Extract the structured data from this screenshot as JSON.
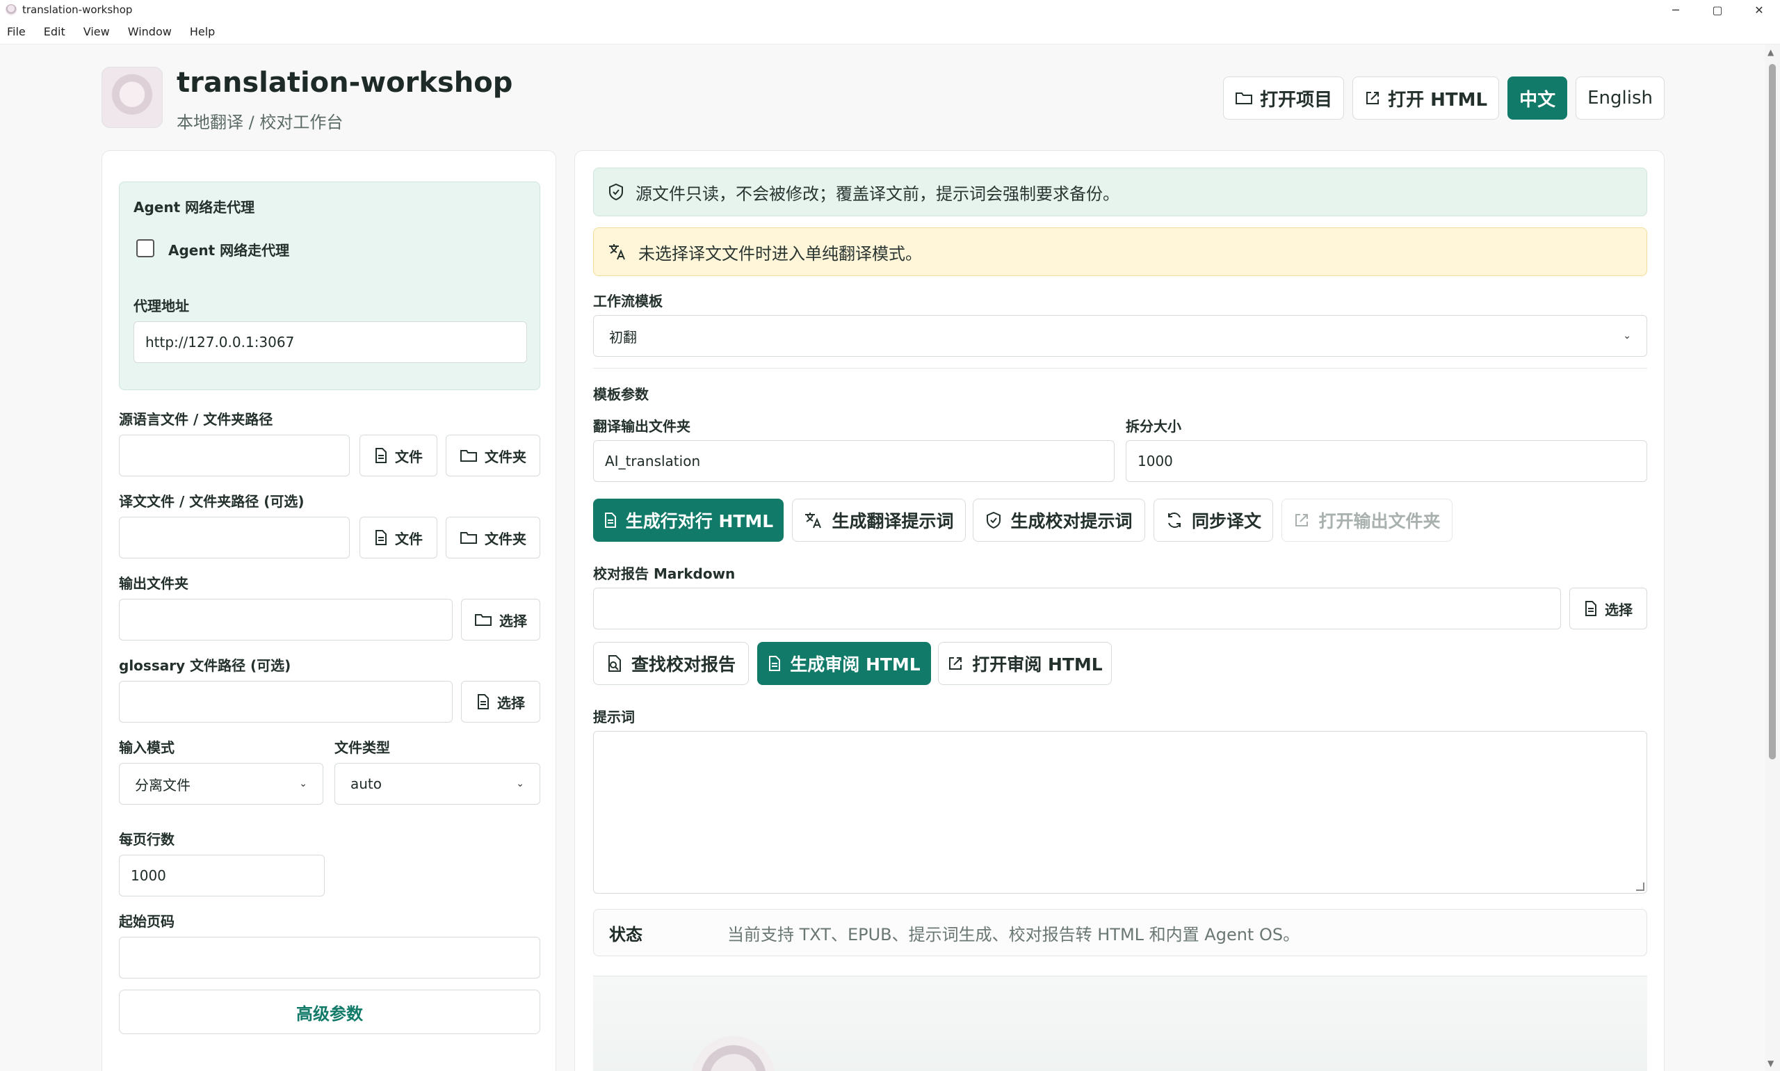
{
  "window": {
    "title": "translation-workshop",
    "controls": {
      "minimize": "─",
      "maximize": "▢",
      "close": "✕"
    }
  },
  "menu": [
    "File",
    "Edit",
    "View",
    "Window",
    "Help"
  ],
  "header": {
    "title": "translation-workshop",
    "subtitle": "本地翻译 / 校对工作台",
    "actions": {
      "open_project": "打开项目",
      "open_html": "打开 HTML",
      "lang_zh": "中文",
      "lang_en": "English"
    }
  },
  "left": {
    "proxy": {
      "section_title": "Agent 网络走代理",
      "checkbox_label": "Agent 网络走代理",
      "checked": false,
      "address_label": "代理地址",
      "address_value": "http://127.0.0.1:3067"
    },
    "source": {
      "label": "源语言文件 / 文件夹路径",
      "value": "",
      "file_btn": "文件",
      "folder_btn": "文件夹"
    },
    "target": {
      "label": "译文文件 / 文件夹路径 (可选)",
      "value": "",
      "file_btn": "文件",
      "folder_btn": "文件夹"
    },
    "output": {
      "label": "输出文件夹",
      "value": "",
      "choose_btn": "选择"
    },
    "glossary": {
      "label": "glossary 文件路径 (可选)",
      "value": "",
      "choose_btn": "选择"
    },
    "input_mode": {
      "label": "输入模式",
      "value": "分离文件"
    },
    "file_type": {
      "label": "文件类型",
      "value": "auto"
    },
    "lines_per_page": {
      "label": "每页行数",
      "value": "1000"
    },
    "start_page": {
      "label": "起始页码",
      "value": ""
    },
    "advanced_btn": "高级参数"
  },
  "right": {
    "notice_readonly": "源文件只读，不会被修改；覆盖译文前，提示词会强制要求备份。",
    "notice_mode": "未选择译文文件时进入单纯翻译模式。",
    "workflow": {
      "label": "工作流模板",
      "value": "初翻"
    },
    "template_params_label": "模板参数",
    "output_folder": {
      "label": "翻译输出文件夹",
      "value": "AI_translation"
    },
    "split_size": {
      "label": "拆分大小",
      "value": "1000"
    },
    "actions1": {
      "gen_parallel_html": "生成行对行 HTML",
      "gen_translate_prompt": "生成翻译提示词",
      "gen_review_prompt": "生成校对提示词",
      "sync_translation": "同步译文",
      "open_output_folder": "打开输出文件夹"
    },
    "report": {
      "label": "校对报告 Markdown",
      "value": "",
      "choose_btn": "选择"
    },
    "actions2": {
      "find_report": "查找校对报告",
      "gen_review_html": "生成审阅 HTML",
      "open_review_html": "打开审阅 HTML"
    },
    "prompt": {
      "label": "提示词",
      "value": ""
    },
    "status": {
      "key": "状态",
      "value": "当前支持 TXT、EPUB、提示词生成、校对报告转 HTML 和内置 Agent OS。"
    }
  },
  "colors": {
    "accent": "#127a68",
    "notice_green": "#e7f4ee",
    "notice_yellow": "#fff6d9"
  },
  "icons": [
    "folder-icon",
    "external-link-icon",
    "file-icon",
    "translate-icon",
    "shield-icon",
    "sync-icon",
    "file-search-icon",
    "chevron-down-icon"
  ]
}
